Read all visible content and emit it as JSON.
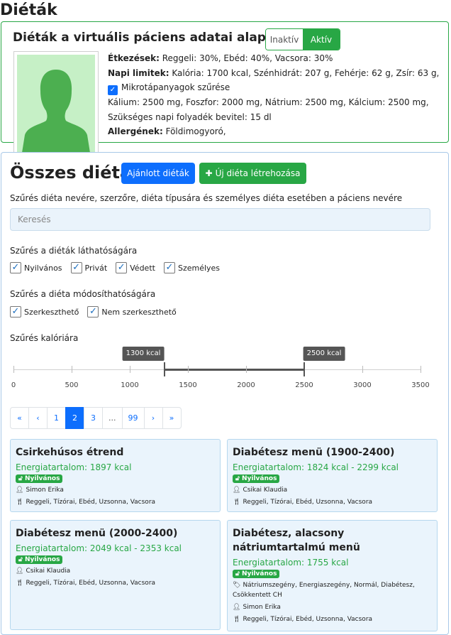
{
  "page_title": "Diéták",
  "patient": {
    "title": "Diéták a virtuális páciens adatai alapján",
    "toggle": {
      "off_label": "Inaktív",
      "on_label": "Aktív"
    },
    "meals_label": "Étkezések:",
    "meals_value": "Reggeli: 30%, Ebéd: 40%, Vacsora: 30%",
    "limits_label": "Napi limitek:",
    "limits_value": "Kalória: 1700 kcal, Szénhidrát: 207 g, Fehérje: 62 g, Zsír: 63 g,",
    "micro_filter": "Mikrotápanyagok szűrése",
    "minerals": "Kálium: 2500 mg, Foszfor: 2000 mg, Nátrium: 2500 mg, Kálcium: 2500 mg,",
    "fluid": "Szükséges napi folyadék bevitel: 15 dl",
    "allergens_label": "Allergének:",
    "allergens_value": "Földimogyoró,"
  },
  "section": {
    "title": "Összes diéta",
    "recommended_button": "Ajánlott diéták",
    "new_button": "Új diéta létrehozása",
    "search_label": "Szűrés diéta nevére, szerzőre, diéta típusára és személyes diéta esetében a páciens nevére",
    "search_placeholder": "Keresés",
    "visibility_label": "Szűrés a diéták láthatóságára",
    "visibility_options": [
      "Nyilvános",
      "Privát",
      "Védett",
      "Személyes"
    ],
    "edit_label": "Szűrés a diéta módosíthatóságára",
    "edit_options": [
      "Szerkeszthető",
      "Nem szerkeszthető"
    ],
    "calorie_label": "Szűrés kalóriára",
    "slider": {
      "min": 0,
      "max": 3500,
      "low": 1300,
      "high": 2500,
      "low_label": "1300 kcal",
      "high_label": "2500 kcal",
      "ticks": [
        "0",
        "500",
        "1000",
        "1500",
        "2000",
        "2500",
        "3000",
        "3500"
      ]
    },
    "pagination": [
      "«",
      "‹",
      "1",
      "2",
      "3",
      "...",
      "99",
      "›",
      "»"
    ],
    "active_page": "2"
  },
  "diets": [
    {
      "title": "Csirkehúsos étrend",
      "energy": "Energiatartalom: 1897 kcal",
      "badge": "Nyilvános",
      "author": "Simon Erika",
      "meals": "Reggeli, Tízórai, Ebéd, Uzsonna, Vacsora"
    },
    {
      "title": "Diabétesz menü (1900-2400)",
      "energy": "Energiatartalom: 1824 kcal - 2299 kcal",
      "badge": "Nyilvános",
      "author": "Csikai Klaudia",
      "meals": "Reggeli, Tízórai, Ebéd, Uzsonna, Vacsora"
    },
    {
      "title": "Diabétesz menü (2000-2400)",
      "energy": "Energiatartalom: 2049 kcal - 2353 kcal",
      "badge": "Nyilvános",
      "author": "Csikai Klaudia",
      "meals": "Reggeli, Tízórai, Ebéd, Uzsonna, Vacsora"
    },
    {
      "title": "Diabétesz, alacsony nátriumtartalmú menü",
      "energy": "Energiatartalom: 1755 kcal",
      "badge": "Nyilvános",
      "tags": "Nátriumszegény, Energiaszegény, Normál, Diabétesz, Csökkentett CH",
      "author": "Simon Erika",
      "meals": "Reggeli, Tízórai, Ebéd, Uzsonna, Vacsora"
    }
  ]
}
